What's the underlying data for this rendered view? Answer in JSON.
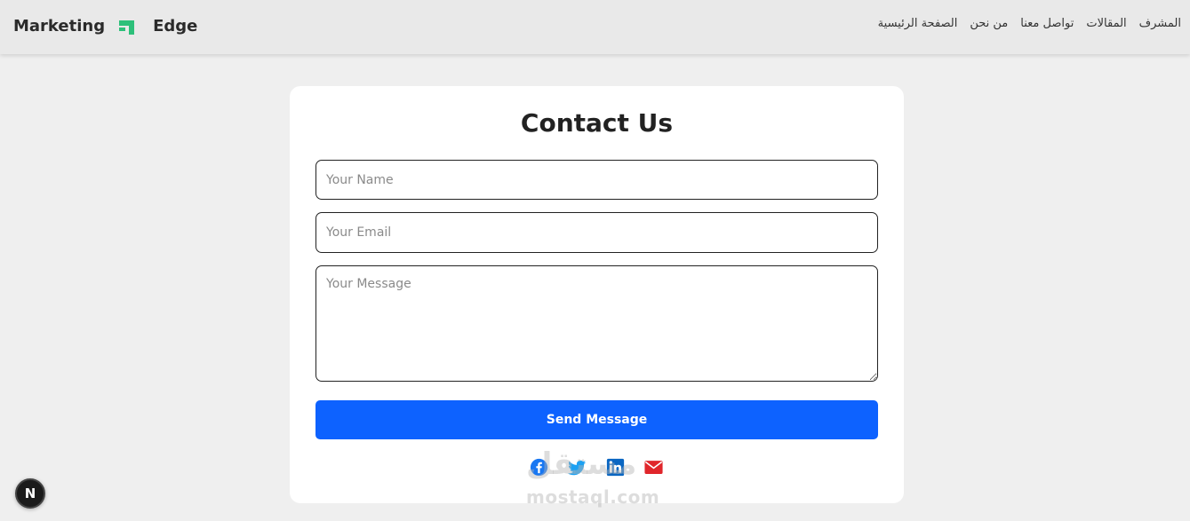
{
  "navbar": {
    "brand_left": "Marketing",
    "brand_right": "Edge",
    "logo_icon": "arrow-logo-icon",
    "logo_color": "#2dc07a",
    "links": [
      "الصفحة الرئيسية",
      "من نحن",
      "تواصل معنا",
      "المقالات",
      "المشرف"
    ]
  },
  "contact": {
    "title": "Contact Us",
    "name_placeholder": "Your Name",
    "email_placeholder": "Your Email",
    "message_placeholder": "Your Message",
    "send_label": "Send Message",
    "send_color": "#0d62ff"
  },
  "socials": [
    {
      "icon": "facebook-icon",
      "color": "#1877f2"
    },
    {
      "icon": "twitter-icon",
      "color": "#1da1f2"
    },
    {
      "icon": "linkedin-icon",
      "color": "#0a66c2"
    },
    {
      "icon": "envelope-icon",
      "color": "#e0262b"
    }
  ],
  "watermark": {
    "arabic": "مستقل",
    "latin": "mostaql.com"
  },
  "dev_badge": {
    "label": "N"
  }
}
